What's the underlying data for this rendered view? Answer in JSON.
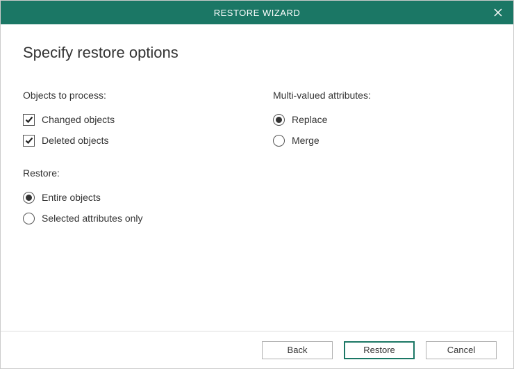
{
  "titlebar": {
    "title": "RESTORE WIZARD"
  },
  "page": {
    "heading": "Specify restore options"
  },
  "left": {
    "objects_label": "Objects to process:",
    "changed_label": "Changed objects",
    "changed_checked": true,
    "deleted_label": "Deleted objects",
    "deleted_checked": true,
    "restore_label": "Restore:",
    "entire_label": "Entire objects",
    "entire_selected": true,
    "selected_attrs_label": "Selected attributes only",
    "selected_attrs_selected": false
  },
  "right": {
    "multi_label": "Multi-valued attributes:",
    "replace_label": "Replace",
    "replace_selected": true,
    "merge_label": "Merge",
    "merge_selected": false
  },
  "footer": {
    "back": "Back",
    "restore": "Restore",
    "cancel": "Cancel"
  }
}
